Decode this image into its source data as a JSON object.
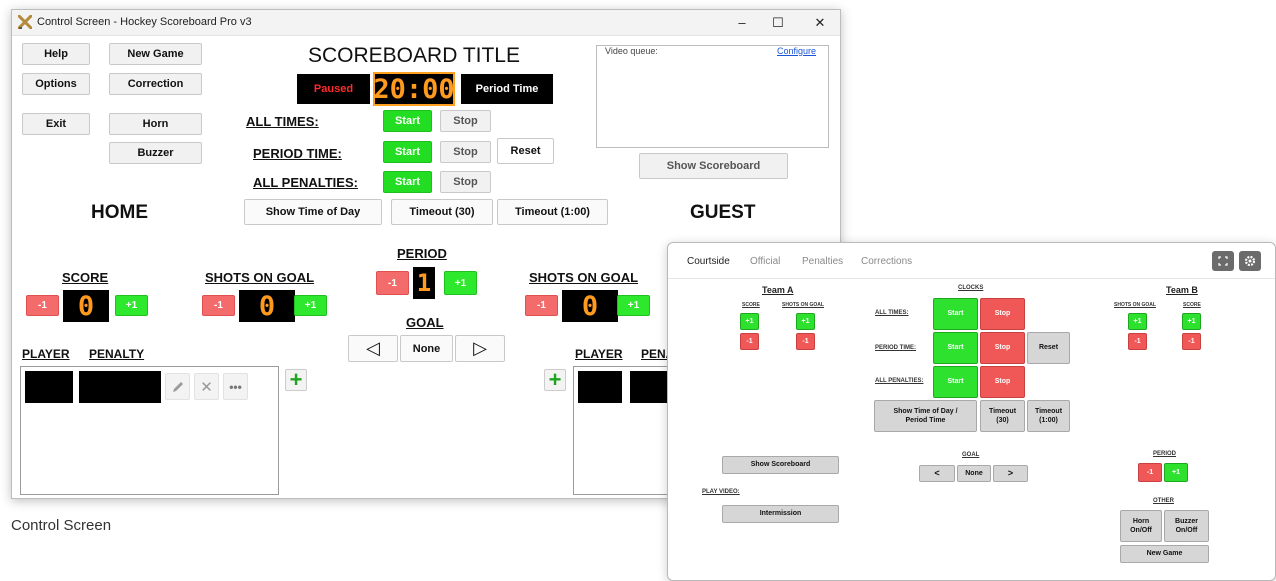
{
  "window": {
    "title": "Control Screen - Hockey Scoreboard Pro v3",
    "minimize": "–",
    "maximize": "☐",
    "close": "✕"
  },
  "control": {
    "left_buttons": {
      "help": "Help",
      "options": "Options",
      "exit": "Exit"
    },
    "mid_buttons": {
      "new_game": "New Game",
      "correction": "Correction",
      "horn": "Horn",
      "buzzer": "Buzzer"
    },
    "scoreboard_title": "SCOREBOARD TITLE",
    "clock": {
      "status": "Paused",
      "time": "20:00",
      "mode": "Period Time"
    },
    "all_times": {
      "label": "ALL TIMES:",
      "start": "Start",
      "stop": "Stop"
    },
    "period_time": {
      "label": "PERIOD TIME:",
      "start": "Start",
      "stop": "Stop",
      "reset": "Reset"
    },
    "all_penalties": {
      "label": "ALL PENALTIES:",
      "start": "Start",
      "stop": "Stop"
    },
    "show_time_of_day": "Show Time of Day",
    "timeout_30": "Timeout (30)",
    "timeout_100": "Timeout (1:00)",
    "video_queue": {
      "label": "Video queue:",
      "configure": "Configure"
    },
    "show_scoreboard": "Show Scoreboard",
    "home": "HOME",
    "guest": "GUEST",
    "home_score": {
      "label": "SCORE",
      "minus": "-1",
      "value": "0",
      "plus": "+1"
    },
    "home_shots": {
      "label": "SHOTS ON GOAL",
      "minus": "-1",
      "value": "0",
      "plus": "+1"
    },
    "period": {
      "label": "PERIOD",
      "minus": "-1",
      "value": "1",
      "plus": "+1"
    },
    "goal": {
      "label": "GOAL",
      "left": "◁",
      "value": "None",
      "right": "▷"
    },
    "guest_shots": {
      "label": "SHOTS ON GOAL",
      "minus": "-1",
      "value": "0",
      "plus": "+1"
    },
    "home_penalty": {
      "player": "PLAYER",
      "penalty": "PENALTY",
      "add": "+"
    },
    "guest_penalty": {
      "player": "PLAYER",
      "penalty": "PENA",
      "add": "+"
    }
  },
  "caption": "Control Screen",
  "panel": {
    "tabs": [
      "Courtside",
      "Official",
      "Penalties",
      "Corrections"
    ],
    "team_a": {
      "title": "Team A",
      "score": "SCORE",
      "shots": "SHOTS ON GOAL",
      "plus": "+1",
      "minus": "-1"
    },
    "clocks": {
      "title": "CLOCKS",
      "all_times": "ALL TIMES:",
      "period_time": "PERIOD TIME:",
      "all_penalties": "ALL PENALTIES:",
      "start": "Start",
      "stop": "Stop",
      "reset": "Reset",
      "show_time_line1": "Show Time of Day /",
      "show_time_line2": "Period Time",
      "timeout30_line1": "Timeout",
      "timeout30_line2": "(30)",
      "timeout100_line1": "Timeout",
      "timeout100_line2": "(1:00)"
    },
    "team_b": {
      "title": "Team B",
      "shots": "SHOTS ON GOAL",
      "score": "SCORE",
      "plus": "+1",
      "minus": "-1"
    },
    "show_scoreboard": "Show Scoreboard",
    "play_video": "PLAY VIDEO:",
    "intermission": "Intermission",
    "goal": {
      "title": "GOAL",
      "left": "<",
      "value": "None",
      "right": ">"
    },
    "period": {
      "title": "PERIOD",
      "minus": "-1",
      "plus": "+1"
    },
    "other": {
      "title": "OTHER",
      "horn_line1": "Horn",
      "horn_line2": "On/Off",
      "buzzer_line1": "Buzzer",
      "buzzer_line2": "On/Off",
      "new_game": "New Game"
    }
  }
}
